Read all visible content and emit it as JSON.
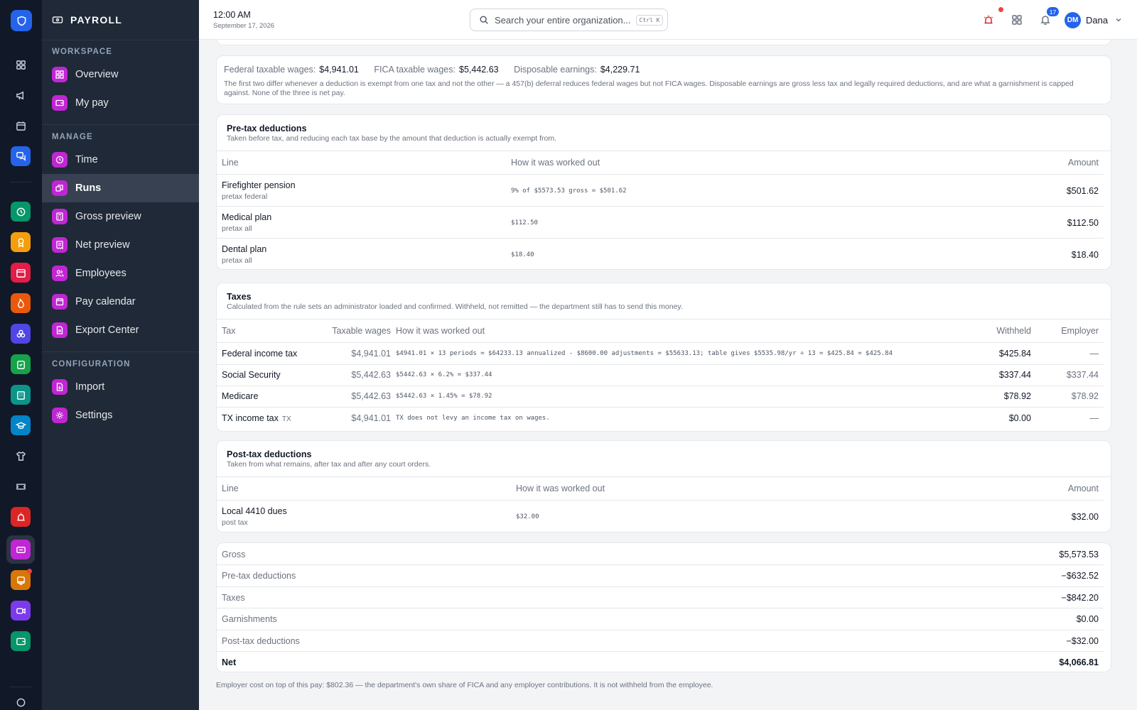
{
  "app": {
    "title": "PAYROLL"
  },
  "topbar": {
    "time": "12:00 AM",
    "date": "September 17, 2026",
    "search_placeholder": "Search your entire organization...",
    "search_shortcut": "Ctrl K",
    "notification_count": "17",
    "user_initials": "DM",
    "user_name": "Dana"
  },
  "sidebar": {
    "sections": [
      {
        "title": "WORKSPACE",
        "items": [
          {
            "label": "Overview",
            "icon": "dashboard-icon"
          },
          {
            "label": "My pay",
            "icon": "wallet-icon"
          }
        ]
      },
      {
        "title": "MANAGE",
        "items": [
          {
            "label": "Time",
            "icon": "clock-icon"
          },
          {
            "label": "Runs",
            "icon": "runs-icon",
            "active": true
          },
          {
            "label": "Gross preview",
            "icon": "calculator-icon"
          },
          {
            "label": "Net preview",
            "icon": "receipt-icon"
          },
          {
            "label": "Employees",
            "icon": "users-icon"
          },
          {
            "label": "Pay calendar",
            "icon": "calendar-icon"
          },
          {
            "label": "Export Center",
            "icon": "file-icon"
          }
        ]
      },
      {
        "title": "CONFIGURATION",
        "items": [
          {
            "label": "Import",
            "icon": "import-icon"
          },
          {
            "label": "Settings",
            "icon": "gear-icon"
          }
        ]
      }
    ]
  },
  "wages": {
    "federal_label": "Federal taxable wages:",
    "federal_value": "$4,941.01",
    "fica_label": "FICA taxable wages:",
    "fica_value": "$5,442.63",
    "disposable_label": "Disposable earnings:",
    "disposable_value": "$4,229.71",
    "note": "The first two differ whenever a deduction is exempt from one tax and not the other — a 457(b) deferral reduces federal wages but not FICA wages. Disposable earnings are gross less tax and legally required deductions, and are what a garnishment is capped against. None of the three is net pay."
  },
  "pretax": {
    "title": "Pre-tax deductions",
    "subtitle": "Taken before tax, and reducing each tax base by the amount that deduction is actually exempt from.",
    "columns": {
      "line": "Line",
      "how": "How it was worked out",
      "amount": "Amount"
    },
    "rows": [
      {
        "line": "Firefighter pension",
        "sub": "pretax federal",
        "how": "9% of $5573.53 gross = $501.62",
        "amount": "$501.62"
      },
      {
        "line": "Medical plan",
        "sub": "pretax all",
        "how": "$112.50",
        "amount": "$112.50"
      },
      {
        "line": "Dental plan",
        "sub": "pretax all",
        "how": "$18.40",
        "amount": "$18.40"
      }
    ]
  },
  "taxes": {
    "title": "Taxes",
    "subtitle": "Calculated from the rule sets an administrator loaded and confirmed. Withheld, not remitted — the department still has to send this money.",
    "columns": {
      "tax": "Tax",
      "taxable": "Taxable wages",
      "how": "How it was worked out",
      "withheld": "Withheld",
      "employer": "Employer"
    },
    "rows": [
      {
        "tax": "Federal income tax",
        "tag": "",
        "taxable": "$4,941.01",
        "how": "$4941.01 × 13 periods = $64233.13 annualized - $8600.00 adjustments = $55633.13; table gives $5535.98/yr ÷ 13 = $425.84 = $425.84",
        "withheld": "$425.84",
        "employer": "—"
      },
      {
        "tax": "Social Security",
        "tag": "",
        "taxable": "$5,442.63",
        "how": "$5442.63 × 6.2% = $337.44",
        "withheld": "$337.44",
        "employer": "$337.44"
      },
      {
        "tax": "Medicare",
        "tag": "",
        "taxable": "$5,442.63",
        "how": "$5442.63 × 1.45% = $78.92",
        "withheld": "$78.92",
        "employer": "$78.92"
      },
      {
        "tax": "TX income tax",
        "tag": "TX",
        "taxable": "$4,941.01",
        "how": "TX does not levy an income tax on wages.",
        "withheld": "$0.00",
        "employer": "—"
      }
    ]
  },
  "posttax": {
    "title": "Post-tax deductions",
    "subtitle": "Taken from what remains, after tax and after any court orders.",
    "columns": {
      "line": "Line",
      "how": "How it was worked out",
      "amount": "Amount"
    },
    "rows": [
      {
        "line": "Local 4410 dues",
        "sub": "post tax",
        "how": "$32.00",
        "amount": "$32.00"
      }
    ]
  },
  "summary": {
    "rows": [
      {
        "label": "Gross",
        "value": "$5,573.53"
      },
      {
        "label": "Pre-tax deductions",
        "value": "−$632.52"
      },
      {
        "label": "Taxes",
        "value": "−$842.20"
      },
      {
        "label": "Garnishments",
        "value": "$0.00"
      },
      {
        "label": "Post-tax deductions",
        "value": "−$32.00"
      },
      {
        "label": "Net",
        "value": "$4,066.81"
      }
    ]
  },
  "footnote": "Employer cost on top of this pay: $802.36 — the department's own share of FICA and any employer contributions. It is not withheld from the employee.",
  "colors": {
    "accent": "#2563eb",
    "sidebar_icon": "#c026d3",
    "rail_bg": "#111827",
    "sidebar_bg": "#1f2937"
  }
}
